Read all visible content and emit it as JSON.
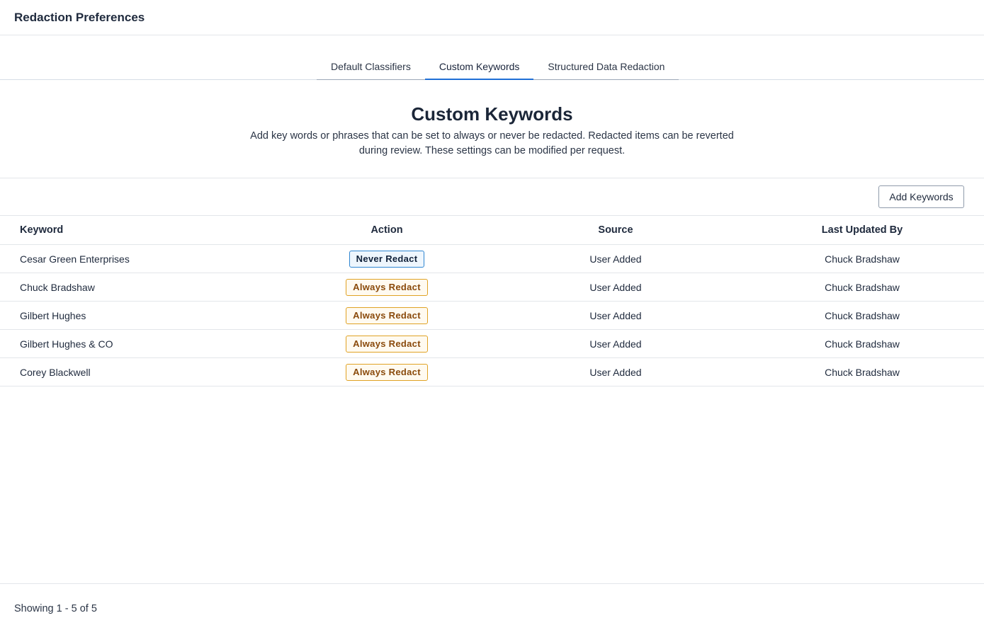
{
  "header": {
    "title": "Redaction Preferences"
  },
  "tabs": [
    {
      "label": "Default Classifiers",
      "active": false
    },
    {
      "label": "Custom Keywords",
      "active": true
    },
    {
      "label": "Structured Data Redaction",
      "active": false
    }
  ],
  "intro": {
    "heading": "Custom Keywords",
    "description": "Add key words or phrases that can be set to always or never be redacted. Redacted items can be reverted during review. These settings can be modified per request."
  },
  "toolbar": {
    "add_label": "Add Keywords"
  },
  "table": {
    "columns": {
      "keyword": "Keyword",
      "action": "Action",
      "source": "Source",
      "updated": "Last Updated By"
    },
    "rows": [
      {
        "keyword": "Cesar Green Enterprises",
        "action": "Never Redact",
        "source": "User Added",
        "updated": "Chuck Bradshaw"
      },
      {
        "keyword": "Chuck Bradshaw",
        "action": "Always Redact",
        "source": "User Added",
        "updated": "Chuck Bradshaw"
      },
      {
        "keyword": "Gilbert Hughes",
        "action": "Always Redact",
        "source": "User Added",
        "updated": "Chuck Bradshaw"
      },
      {
        "keyword": "Gilbert Hughes & CO",
        "action": "Always Redact",
        "source": "User Added",
        "updated": "Chuck Bradshaw"
      },
      {
        "keyword": "Corey Blackwell",
        "action": "Always Redact",
        "source": "User Added",
        "updated": "Chuck Bradshaw"
      }
    ]
  },
  "footer": {
    "showing": "Showing 1 - 5 of 5"
  },
  "colors": {
    "tab_active": "#1f6fd6",
    "never_border": "#2f86d1",
    "always_border": "#e0a224",
    "always_text": "#8a4a0b"
  }
}
